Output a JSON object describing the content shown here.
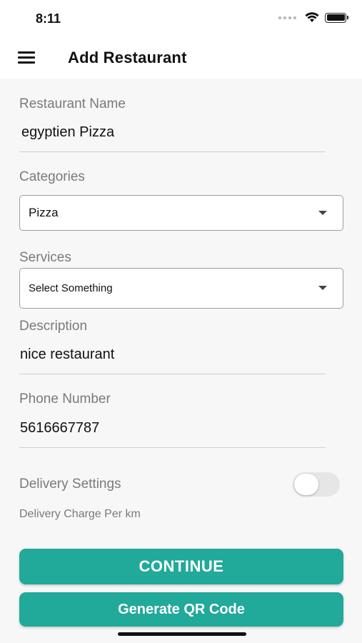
{
  "status": {
    "time": "8:11"
  },
  "header": {
    "title": "Add Restaurant"
  },
  "form": {
    "restaurant_name": {
      "label": "Restaurant Name",
      "value": "egyptien Pizza"
    },
    "categories": {
      "label": "Categories",
      "value": "Pizza"
    },
    "services": {
      "label": "Services",
      "value": "Select Something"
    },
    "description": {
      "label": "Description",
      "value": "nice restaurant"
    },
    "phone": {
      "label": "Phone Number",
      "value": "5616667787"
    },
    "delivery": {
      "label": "Delivery Settings",
      "enabled": false
    },
    "delivery_charge": {
      "label": "Delivery Charge Per km"
    }
  },
  "buttons": {
    "continue": "CONTINUE",
    "qr": "Generate QR Code"
  },
  "colors": {
    "accent": "#21a99a"
  }
}
